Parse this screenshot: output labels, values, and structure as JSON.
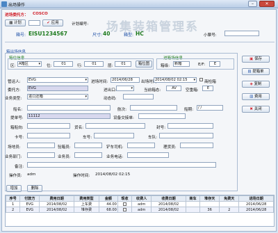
{
  "window": {
    "title": "出场操作"
  },
  "watermark": "场集装箱管理系",
  "header": {
    "party_label": "进场委托方：",
    "party_value": "COSCO",
    "calc_btn": "计划",
    "apply_btn": "应用",
    "plan_no_label": "计划编号:",
    "plan_no_value": "",
    "container_label": "箱号:",
    "container_value": "EISU1234567",
    "size_label": "尺寸:",
    "size_value": "40",
    "type_label": "箱型:",
    "type_value": "HC",
    "ticket_label": "小票号:",
    "ticket_value": ""
  },
  "section": {
    "exit_info": "箱出场信息",
    "position_info": "箱位信息",
    "entry_info": "进箱场信息"
  },
  "position": {
    "area_label": "区:",
    "area_value": "A箱区",
    "slot_label": "位:",
    "slot_value": "01",
    "row_label": "行:",
    "row_value": "01",
    "tier_label": "层:",
    "tier_value": "01",
    "map_btn": "箱位图"
  },
  "entry": {
    "grade_label": "箱级:",
    "grade_value": "新箱",
    "status_label": "E/F:",
    "status_value": "E"
  },
  "form": {
    "manager_label": "管运人:",
    "manager_value": "EVG",
    "entry_time_label": "进场时间:",
    "entry_time_value": "2014/06/28",
    "exit_time_label": "出场时间:",
    "exit_time_value": "2014/08/02 02:15",
    "commercial_label": "商检箱",
    "agent_label": "委托方:",
    "agent_value": "EVG",
    "exit_port_label": "进出口:",
    "exit_port_value": "",
    "current_status_label": "当前箱态:",
    "current_status_value": "AV",
    "empty_label": "空重箱:",
    "empty_value": "E",
    "biz_type_label": "业务类型:",
    "biz_type_value": "进口还箱",
    "power_label": "动态码:",
    "power_value": "",
    "vessel_label": "船名:",
    "vessel_value": "",
    "voyage_label": "航次:",
    "voyage_value": "",
    "vessel_date_label": "船期:",
    "vessel_date_value": "/ /",
    "bill_label": "提单号:",
    "bill_value": "11112",
    "equipment_label": "设备交接单:",
    "equipment_value": "",
    "dest_label": "箱船向:",
    "dest_value": "",
    "goods_label": "货名:",
    "goods_value": "",
    "seal_label": "封号:",
    "seal_value": "",
    "truck_label": "卡号:",
    "truck_value": "",
    "plate_label": "车号:",
    "plate_value": "",
    "fleet_label": "车队:",
    "fleet_value": "",
    "site_label": "场地员:",
    "site_value": "",
    "inspector_label": "验箱员:",
    "inspector_value": "",
    "forklift_label": "铲车司机:",
    "forklift_value": "",
    "tally_label": "理货员:",
    "tally_value": "",
    "dept_label": "业务部门:",
    "dept_value": "",
    "clerk_label": "业务员:",
    "clerk_value": "",
    "tel_label": "业务电话:",
    "tel_value": "",
    "remark_label": "备注:",
    "remark_value": "",
    "operator_label": "操作员:",
    "operator_value": "adm",
    "op_time_label": "操作时间:",
    "op_time_value": "2014/08/02 02:15"
  },
  "side_buttons": {
    "save": "保存",
    "send": "提箱单",
    "copy": "复制",
    "fee": "费用",
    "close": "关闭"
  },
  "fee_buttons": {
    "add": "增加",
    "delete": "删除"
  },
  "fee_table": {
    "headers": [
      "序号",
      "付款方",
      "费用日期",
      "费用类型",
      "金额",
      "现收",
      "收费人",
      "收费日期",
      "商车",
      "堆存天",
      "免费天",
      "进场日期"
    ],
    "rows": [
      [
        "1",
        "EVG",
        "2014/08/02",
        "上车费",
        "44.00",
        "",
        "adm",
        "2014/08/02",
        "",
        "",
        "",
        "2014/06/28"
      ],
      [
        "2",
        "EVG",
        "2014/08/02",
        "堆存费",
        "68.00",
        "",
        "adm",
        "2014/08/02",
        "",
        "36",
        "2",
        "2014/06/28"
      ]
    ]
  }
}
